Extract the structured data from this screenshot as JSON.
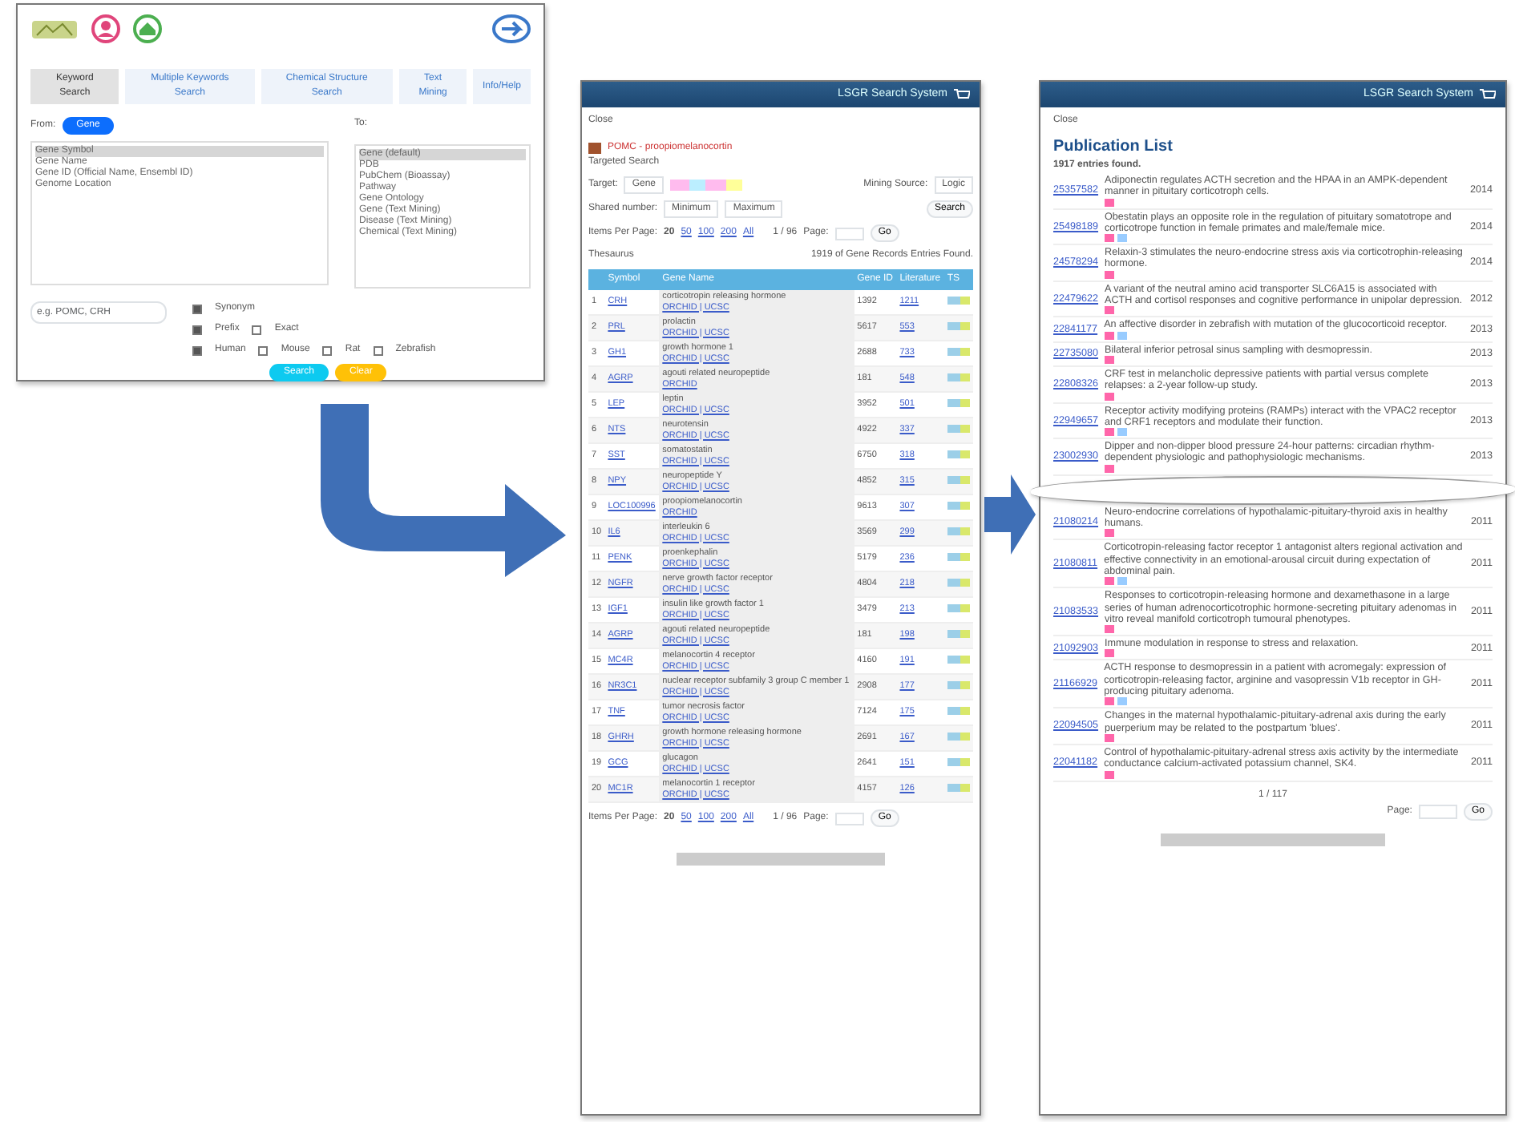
{
  "search_window": {
    "tabs": [
      {
        "label": "Keyword Search",
        "selected": true
      },
      {
        "label": "Multiple Keywords Search",
        "selected": false
      },
      {
        "label": "Chemical Structure Search",
        "selected": false
      },
      {
        "label": "Text Mining",
        "selected": false
      },
      {
        "label": "Info/Help",
        "selected": false
      }
    ],
    "from_label": "From:",
    "from_button": "Gene",
    "to_label": "To:",
    "from_list": [
      {
        "label": "Gene Symbol",
        "selected": true
      },
      {
        "label": "Gene Name",
        "selected": false
      },
      {
        "label": "Gene ID (Official Name, Ensembl ID)",
        "selected": false
      },
      {
        "label": "Genome Location",
        "selected": false
      }
    ],
    "to_list": [
      {
        "label": "Gene (default)",
        "selected": true
      },
      {
        "label": "PDB",
        "selected": false
      },
      {
        "label": "PubChem (Bioassay)",
        "selected": false
      },
      {
        "label": "Pathway",
        "selected": false
      },
      {
        "label": "Gene Ontology",
        "selected": false
      },
      {
        "label": "Gene (Text Mining)",
        "selected": false
      },
      {
        "label": "Disease (Text Mining)",
        "selected": false
      },
      {
        "label": "Chemical (Text Mining)",
        "selected": false
      }
    ],
    "query_placeholder": "e.g. POMC, CRH",
    "option_rows": [
      [
        {
          "label": "Synonym",
          "checked": true
        }
      ],
      [
        {
          "label": "Prefix",
          "checked": true
        },
        {
          "label": "Exact",
          "checked": false
        }
      ],
      [
        {
          "label": "Human",
          "checked": true
        },
        {
          "label": "Mouse",
          "checked": false
        },
        {
          "label": "Rat",
          "checked": false
        },
        {
          "label": "Zebrafish",
          "checked": false
        }
      ]
    ],
    "buttons": [
      {
        "label": "Search",
        "kind": "primary"
      },
      {
        "label": "Clear",
        "kind": "warning"
      }
    ]
  },
  "gene_window": {
    "title": "LSGR Search System",
    "close": "Close",
    "query_title": "POMC - proopiomelanocortin",
    "section": "Targeted Search",
    "target_label": "Target:",
    "target_value": "Gene",
    "mining_label": "Mining Source:",
    "mining_value": "Logic",
    "shared_label": "Shared number:",
    "min_value": "Minimum",
    "max_value": "Maximum",
    "search_button": "Search",
    "pagers": [
      {
        "items_label": "Items Per Page:",
        "items_options": [
          {
            "label": "20",
            "selected": true
          },
          {
            "label": "50",
            "selected": false
          },
          {
            "label": "100",
            "selected": false
          },
          {
            "label": "200",
            "selected": false
          },
          {
            "label": "All",
            "selected": false
          }
        ],
        "page_range": "1 / 96",
        "page_label": "Page:",
        "go_button": "Go"
      },
      {
        "items_label": "Items Per Page:",
        "items_options": [
          {
            "label": "20",
            "selected": true
          },
          {
            "label": "50",
            "selected": false
          },
          {
            "label": "100",
            "selected": false
          },
          {
            "label": "200",
            "selected": false
          },
          {
            "label": "All",
            "selected": false
          }
        ],
        "page_range": "1 / 96",
        "page_label": "Page:",
        "go_button": "Go"
      }
    ],
    "found": "1919 of Gene Records Entries Found.",
    "thesaurus": "Thesaurus",
    "columns": [
      "Symbol",
      "Gene Name",
      "Gene ID",
      "Literature",
      "TS"
    ],
    "rows": [
      {
        "no": "1",
        "symbol": "CRH",
        "name": "corticotropin releasing hormone",
        "meta": "ORCHID | UCSC",
        "gene_id": "1392",
        "count": "1211"
      },
      {
        "no": "2",
        "symbol": "PRL",
        "name": "prolactin",
        "meta": "ORCHID | UCSC",
        "gene_id": "5617",
        "count": "553"
      },
      {
        "no": "3",
        "symbol": "GH1",
        "name": "growth hormone 1",
        "meta": "ORCHID | UCSC",
        "gene_id": "2688",
        "count": "733"
      },
      {
        "no": "4",
        "symbol": "AGRP",
        "name": "agouti related neuropeptide",
        "meta": "ORCHID",
        "gene_id": "181",
        "count": "548"
      },
      {
        "no": "5",
        "symbol": "LEP",
        "name": "leptin",
        "meta": "ORCHID | UCSC",
        "gene_id": "3952",
        "count": "501"
      },
      {
        "no": "6",
        "symbol": "NTS",
        "name": "neurotensin",
        "meta": "ORCHID | UCSC",
        "gene_id": "4922",
        "count": "337"
      },
      {
        "no": "7",
        "symbol": "SST",
        "name": "somatostatin",
        "meta": "ORCHID | UCSC",
        "gene_id": "6750",
        "count": "318"
      },
      {
        "no": "8",
        "symbol": "NPY",
        "name": "neuropeptide Y",
        "meta": "ORCHID | UCSC",
        "gene_id": "4852",
        "count": "315"
      },
      {
        "no": "9",
        "symbol": "LOC100996",
        "name": "proopiomelanocortin",
        "meta": "ORCHID",
        "gene_id": "9613",
        "count": "307"
      },
      {
        "no": "10",
        "symbol": "IL6",
        "name": "interleukin 6",
        "meta": "ORCHID | UCSC",
        "gene_id": "3569",
        "count": "299"
      },
      {
        "no": "11",
        "symbol": "PENK",
        "name": "proenkephalin",
        "meta": "ORCHID | UCSC",
        "gene_id": "5179",
        "count": "236"
      },
      {
        "no": "12",
        "symbol": "NGFR",
        "name": "nerve growth factor receptor",
        "meta": "ORCHID | UCSC",
        "gene_id": "4804",
        "count": "218"
      },
      {
        "no": "13",
        "symbol": "IGF1",
        "name": "insulin like growth factor 1",
        "meta": "ORCHID | UCSC",
        "gene_id": "3479",
        "count": "213"
      },
      {
        "no": "14",
        "symbol": "AGRP",
        "name": "agouti related neuropeptide",
        "meta": "ORCHID | UCSC",
        "gene_id": "181",
        "count": "198"
      },
      {
        "no": "15",
        "symbol": "MC4R",
        "name": "melanocortin 4 receptor",
        "meta": "ORCHID | UCSC",
        "gene_id": "4160",
        "count": "191"
      },
      {
        "no": "16",
        "symbol": "NR3C1",
        "name": "nuclear receptor subfamily 3 group C member 1",
        "meta": "ORCHID | UCSC",
        "gene_id": "2908",
        "count": "177"
      },
      {
        "no": "17",
        "symbol": "TNF",
        "name": "tumor necrosis factor",
        "meta": "ORCHID | UCSC",
        "gene_id": "7124",
        "count": "175"
      },
      {
        "no": "18",
        "symbol": "GHRH",
        "name": "growth hormone releasing hormone",
        "meta": "ORCHID | UCSC",
        "gene_id": "2691",
        "count": "167"
      },
      {
        "no": "19",
        "symbol": "GCG",
        "name": "glucagon",
        "meta": "ORCHID | UCSC",
        "gene_id": "2641",
        "count": "151"
      },
      {
        "no": "20",
        "symbol": "MC1R",
        "name": "melanocortin 1 receptor",
        "meta": "ORCHID | UCSC",
        "gene_id": "4157",
        "count": "126"
      }
    ]
  },
  "publication_window": {
    "title": "LSGR Search System",
    "close": "Close",
    "heading": "Publication List",
    "found": "1917 entries found.",
    "entries": [
      {
        "pmid": "25357582",
        "title": "Adiponectin regulates ACTH secretion and the HPAA in an AMPK-dependent manner in pituitary corticotroph cells.",
        "year": "2014"
      },
      {
        "pmid": "25498189",
        "title": "Obestatin plays an opposite role in the regulation of pituitary somatotrope and corticotrope function in female primates and male/female mice.",
        "year": "2014"
      },
      {
        "pmid": "24578294",
        "title": "Relaxin-3 stimulates the neuro-endocrine stress axis via corticotrophin-releasing hormone.",
        "year": "2014"
      },
      {
        "pmid": "22479622",
        "title": "A variant of the neutral amino acid transporter SLC6A15 is associated with ACTH and cortisol responses and cognitive performance in unipolar depression.",
        "year": "2012"
      },
      {
        "pmid": "22841177",
        "title": "An affective disorder in zebrafish with mutation of the glucocorticoid receptor.",
        "year": "2013"
      },
      {
        "pmid": "22735080",
        "title": "Bilateral inferior petrosal sinus sampling with desmopressin.",
        "year": "2013"
      },
      {
        "pmid": "22808326",
        "title": "CRF test in melancholic depressive patients with partial versus complete relapses: a 2-year follow-up study.",
        "year": "2013"
      },
      {
        "pmid": "22949657",
        "title": "Receptor activity modifying proteins (RAMPs) interact with the VPAC2 receptor and CRF1 receptors and modulate their function.",
        "year": "2013"
      },
      {
        "pmid": "23002930",
        "title": "Dipper and non-dipper blood pressure 24-hour patterns: circadian rhythm-dependent physiologic and pathophysiologic mechanisms.",
        "year": "2013"
      },
      {
        "pmid": "21080214",
        "title": "Neuro-endocrine correlations of hypothalamic-pituitary-thyroid axis in healthy humans.",
        "year": "2011"
      },
      {
        "pmid": "21080811",
        "title": "Corticotropin-releasing factor receptor 1 antagonist alters regional activation and effective connectivity in an emotional-arousal circuit during expectation of abdominal pain.",
        "year": "2011"
      },
      {
        "pmid": "21083533",
        "title": "Responses to corticotropin-releasing hormone and dexamethasone in a large series of human adrenocorticotrophic hormone-secreting pituitary adenomas in vitro reveal manifold corticotroph tumoural phenotypes.",
        "year": "2011"
      },
      {
        "pmid": "21092903",
        "title": "Immune modulation in response to stress and relaxation.",
        "year": "2011"
      },
      {
        "pmid": "21166929",
        "title": "ACTH response to desmopressin in a patient with acromegaly: expression of corticotropin-releasing factor, arginine and vasopressin V1b receptor in GH-producing pituitary adenoma.",
        "year": "2011"
      },
      {
        "pmid": "22094505",
        "title": "Changes in the maternal hypothalamic-pituitary-adrenal axis during the early puerperium may be related to the postpartum 'blues'.",
        "year": "2011"
      },
      {
        "pmid": "22041182",
        "title": "Control of hypothalamic-pituitary-adrenal stress axis activity by the intermediate conductance calcium-activated potassium channel, SK4.",
        "year": "2011"
      }
    ],
    "pager": "1 / 117",
    "page_label": "Page:",
    "go_button": "Go"
  }
}
